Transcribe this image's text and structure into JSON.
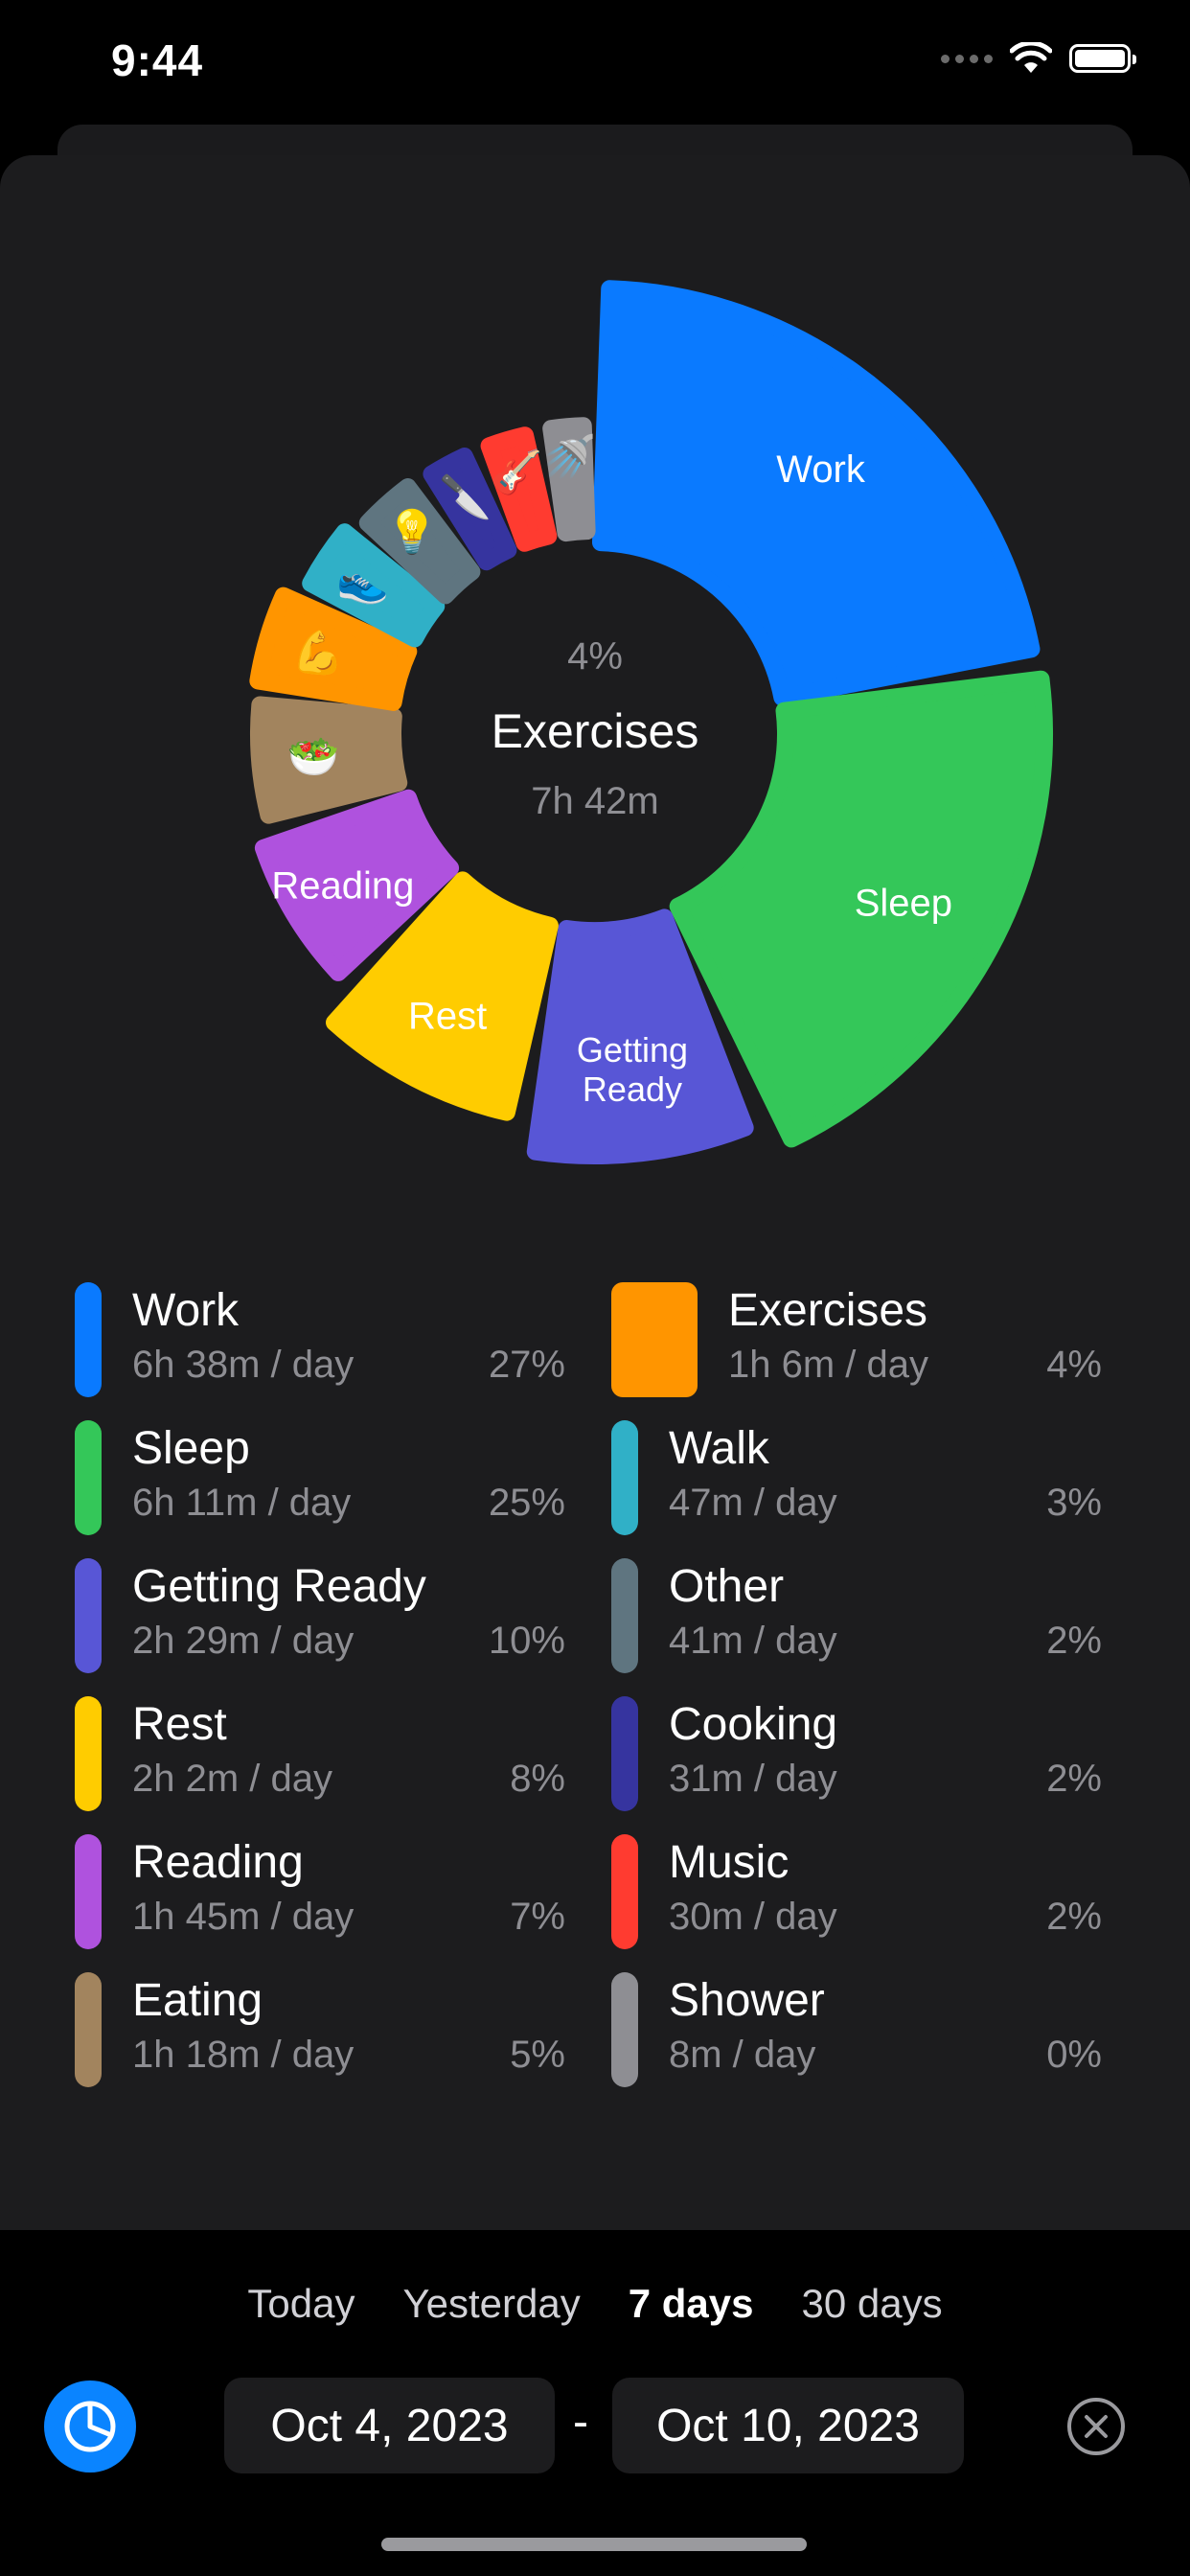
{
  "status_bar": {
    "time": "9:44"
  },
  "center": {
    "percent": "4%",
    "name": "Exercises",
    "time": "7h 42m"
  },
  "segments": [
    {
      "key": "work",
      "label": "Work",
      "icon": "",
      "color": "#0a7aff",
      "percent": 27
    },
    {
      "key": "sleep",
      "label": "Sleep",
      "icon": "",
      "color": "#34c759",
      "percent": 25
    },
    {
      "key": "getting_ready",
      "label": "Getting\nReady",
      "icon": "",
      "color": "#5856d6",
      "percent": 10
    },
    {
      "key": "rest",
      "label": "Rest",
      "icon": "",
      "color": "#ffcc00",
      "percent": 8
    },
    {
      "key": "reading",
      "label": "Reading",
      "icon": "",
      "color": "#af52de",
      "percent": 7
    },
    {
      "key": "eating",
      "label": "",
      "icon": "🥗",
      "color": "#a2845e",
      "percent": 5
    },
    {
      "key": "exercises",
      "label": "",
      "icon": "💪",
      "color": "#ff9500",
      "percent": 4
    },
    {
      "key": "walk",
      "label": "",
      "icon": "👟",
      "color": "#30b0c7",
      "percent": 3
    },
    {
      "key": "other",
      "label": "",
      "icon": "💡",
      "color": "#5f7580",
      "percent": 2
    },
    {
      "key": "cooking",
      "label": "",
      "icon": "🔪",
      "color": "#36349f",
      "percent": 2
    },
    {
      "key": "music",
      "label": "",
      "icon": "🎸",
      "color": "#ff3b30",
      "percent": 2
    },
    {
      "key": "shower",
      "label": "",
      "icon": "🚿",
      "color": "#8e8e93",
      "percent": 0
    }
  ],
  "legend": {
    "left": [
      {
        "name": "Work",
        "time": "6h 38m / day",
        "pct": "27%",
        "color": "#0a7aff"
      },
      {
        "name": "Sleep",
        "time": "6h 11m / day",
        "pct": "25%",
        "color": "#34c759"
      },
      {
        "name": "Getting Ready",
        "time": "2h 29m / day",
        "pct": "10%",
        "color": "#5856d6"
      },
      {
        "name": "Rest",
        "time": "2h 2m / day",
        "pct": "8%",
        "color": "#ffcc00"
      },
      {
        "name": "Reading",
        "time": "1h 45m / day",
        "pct": "7%",
        "color": "#af52de"
      },
      {
        "name": "Eating",
        "time": "1h 18m / day",
        "pct": "5%",
        "color": "#a2845e"
      }
    ],
    "right": [
      {
        "name": "Exercises",
        "time": "1h 6m / day",
        "pct": "4%",
        "color": "#ff9500",
        "selected": true
      },
      {
        "name": "Walk",
        "time": "47m / day",
        "pct": "3%",
        "color": "#30b0c7"
      },
      {
        "name": "Other",
        "time": "41m / day",
        "pct": "2%",
        "color": "#5f7580"
      },
      {
        "name": "Cooking",
        "time": "31m / day",
        "pct": "2%",
        "color": "#36349f"
      },
      {
        "name": "Music",
        "time": "30m / day",
        "pct": "2%",
        "color": "#ff3b30"
      },
      {
        "name": "Shower",
        "time": "8m / day",
        "pct": "0%",
        "color": "#8e8e93"
      }
    ]
  },
  "range_tabs": [
    {
      "label": "Today",
      "active": false
    },
    {
      "label": "Yesterday",
      "active": false
    },
    {
      "label": "7 days",
      "active": true
    },
    {
      "label": "30 days",
      "active": false
    }
  ],
  "date_range": {
    "start": "Oct 4, 2023",
    "separator": "-",
    "end": "Oct 10, 2023"
  },
  "icons": {
    "chart": "pie-chart-icon",
    "close": "close-circle-icon",
    "wifi": "wifi-icon",
    "battery": "battery-icon"
  }
}
